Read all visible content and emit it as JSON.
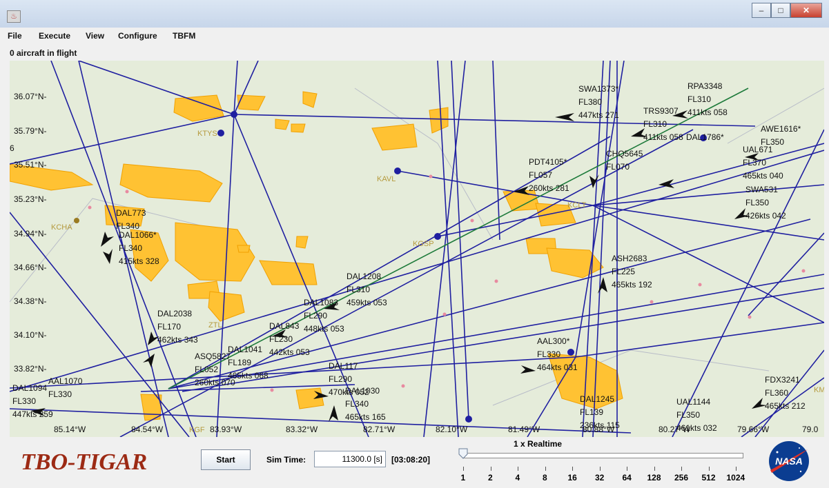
{
  "window": {
    "icon_glyph": "♨",
    "minimize": "–",
    "maximize": "□",
    "close": "✕"
  },
  "menu": [
    "File",
    "Execute",
    "View",
    "Configure",
    "TBFM"
  ],
  "status": "0 aircraft in flight",
  "map": {
    "lat_labels": [
      "36.07°N-",
      "35.79°N-",
      "6",
      "35.51°N-",
      "35.23°N-",
      "34.94°N-",
      "34.66°N-",
      "34.38°N-",
      "34.10°N-",
      "33.82°N-"
    ],
    "lon_labels": [
      "85.14°W",
      "84.54°W",
      "83.93°W",
      "83.32°W",
      "82.71°W",
      "82.10°W",
      "81.49°W",
      "80.88°W",
      "80.27°W",
      "79.66°W",
      "79.0"
    ],
    "airports": [
      "KTYS",
      "KAVL",
      "KCHA",
      "KGSP",
      "KCLT",
      "ZTL",
      "KGF",
      "KM"
    ],
    "aircraft": [
      "SWA1373*\nFL380\n447kts 271",
      "RPA3348\nFL310\n411kts 058",
      "TRS9307\nFL310\n411kts 058",
      "AWE1616*\nFL350",
      "DAL1786*",
      "UAL671\nFL370\n465kts 040",
      "PDT4105*\nFL057\n260kts 281",
      "CHQ5645\nFL070",
      "SWA531\nFL350\n426kts 042",
      "DAL773\nFL340",
      "DAL1066*\nFL340\n415kts 328",
      "ASH2683\nFL225\n465kts 192",
      "DAL1208\nFL310\n459kts 053",
      "DAL1083\nFL290\n448kts 053",
      "DAL2038\nFL170\n462kts 343",
      "DAL843\nFL230\n442kts 053",
      "DAL1041\nFL189\n465kts 068",
      "ASQ5827\nFL052\n260kts 070",
      "DAL117\nFL290\n470kts 052",
      "AAL300*\nFL330\n464kts 031",
      "DAL1245\nFL139\n236kts 115",
      "UAL1144\nFL350\n461kts 032",
      "FDX3241\nFL360\n465kts 212",
      "DAL1030\nFL340\n465kts 165",
      "DAL1094\nFL330\n447kts 259",
      "AAL1070\nFL330"
    ]
  },
  "controls": {
    "logo": "TBO-TIGAR",
    "start": "Start",
    "sim_time_label": "Sim Time:",
    "sim_time_value": "11300.0 [s]",
    "sim_clock": "[03:08:20]",
    "realtime": "1 x Realtime",
    "speeds": [
      "1",
      "2",
      "4",
      "8",
      "16",
      "32",
      "64",
      "128",
      "256",
      "512",
      "1024"
    ],
    "slider_value": 0
  },
  "nasa_logo_text": "NASA",
  "colors": {
    "route": "#1f1fa0",
    "weather": "#ffc233",
    "map_bg": "#e5ecda",
    "logo": "#9c2a14"
  }
}
